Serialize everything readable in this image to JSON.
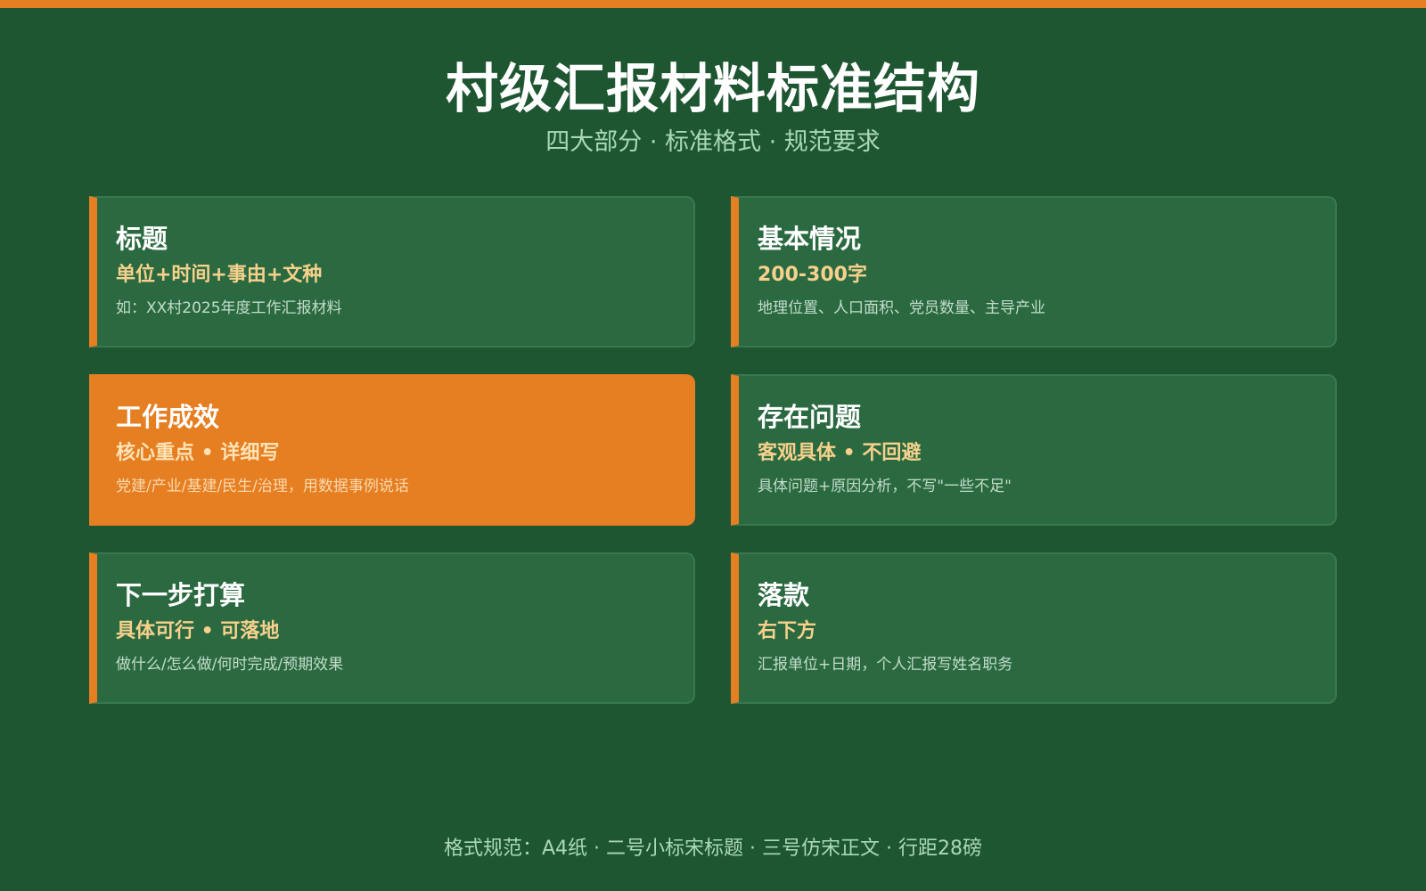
{
  "header": {
    "title": "村级汇报材料标准结构",
    "subtitle": "四大部分 · 标准格式 · 规范要求"
  },
  "colors": {
    "background": "#1f5632",
    "card": "#2b6a41",
    "accent": "#e67e22",
    "highlight_text": "#f7d18c",
    "muted_text": "#a9d8b8"
  },
  "cards": [
    {
      "title": "标题",
      "subtitle": "单位+时间+事由+文种",
      "desc": "如：XX村2025年度工作汇报材料"
    },
    {
      "title": "基本情况",
      "subtitle": "200-300字",
      "desc": "地理位置、人口面积、党员数量、主导产业"
    },
    {
      "title": "工作成效",
      "subtitle": "核心重点 • 详细写",
      "desc": "党建/产业/基建/民生/治理，用数据事例说话",
      "highlighted": true
    },
    {
      "title": "存在问题",
      "subtitle": "客观具体 • 不回避",
      "desc": "具体问题+原因分析，不写\"一些不足\""
    },
    {
      "title": "下一步打算",
      "subtitle": "具体可行 • 可落地",
      "desc": "做什么/怎么做/何时完成/预期效果"
    },
    {
      "title": "落款",
      "subtitle": "右下方",
      "desc": "汇报单位+日期，个人汇报写姓名职务"
    }
  ],
  "footer": {
    "text": "格式规范：A4纸 · 二号小标宋标题 · 三号仿宋正文 · 行距28磅"
  }
}
